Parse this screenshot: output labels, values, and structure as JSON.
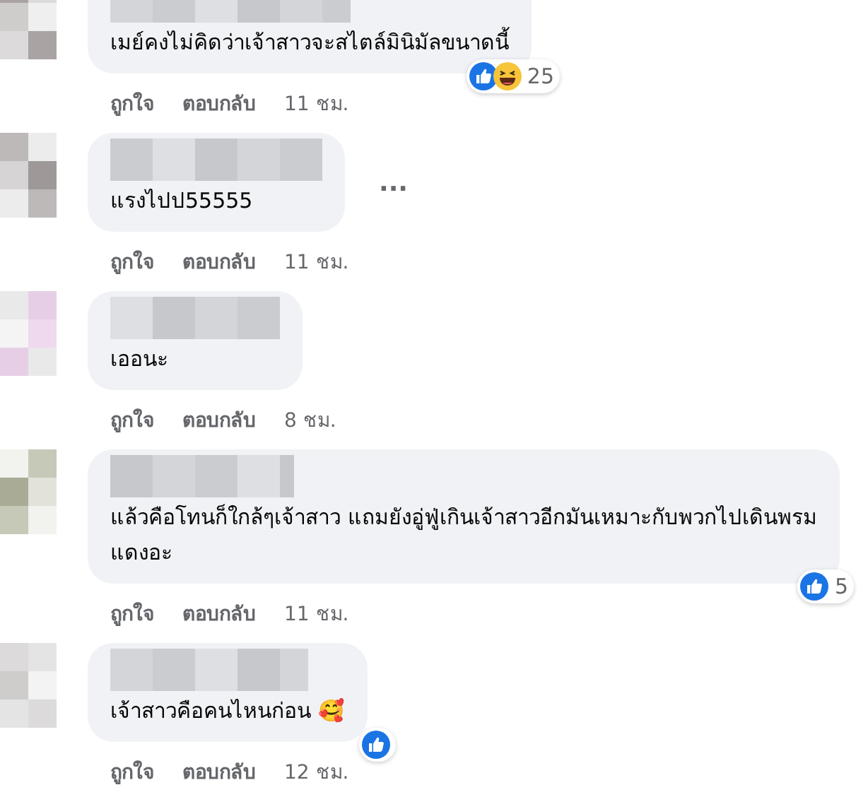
{
  "comments": [
    {
      "text": "เมย์คงไม่คิดว่าเจ้าสาวจะสไตล์มินิมัลขนาดนี้",
      "like": "ถูกใจ",
      "reply": "ตอบกลับ",
      "time": "11 ชม.",
      "reactions": {
        "like": true,
        "haha": true,
        "count": "25"
      }
    },
    {
      "text": "แรงไปป55555",
      "like": "ถูกใจ",
      "reply": "ตอบกลับ",
      "time": "11 ชม.",
      "more": "..."
    },
    {
      "text": "เออนะ",
      "like": "ถูกใจ",
      "reply": "ตอบกลับ",
      "time": "8 ชม."
    },
    {
      "text": "แล้วคือโทนก็ใกล้ๆเจ้าสาว แถมยังอู่ฟู่เกินเจ้าสาวอีกมันเหมาะกับพวกไปเดินพรมแดงอะ",
      "like": "ถูกใจ",
      "reply": "ตอบกลับ",
      "time": "11 ชม.",
      "reactions": {
        "like": true,
        "haha": false,
        "count": "5"
      }
    },
    {
      "text": "เจ้าสาวคือคนไหนก่อน 🥰",
      "like": "ถูกใจ",
      "reply": "ตอบกลับ",
      "time": "12 ชม.",
      "reactions": {
        "like": true,
        "haha": false
      }
    }
  ]
}
